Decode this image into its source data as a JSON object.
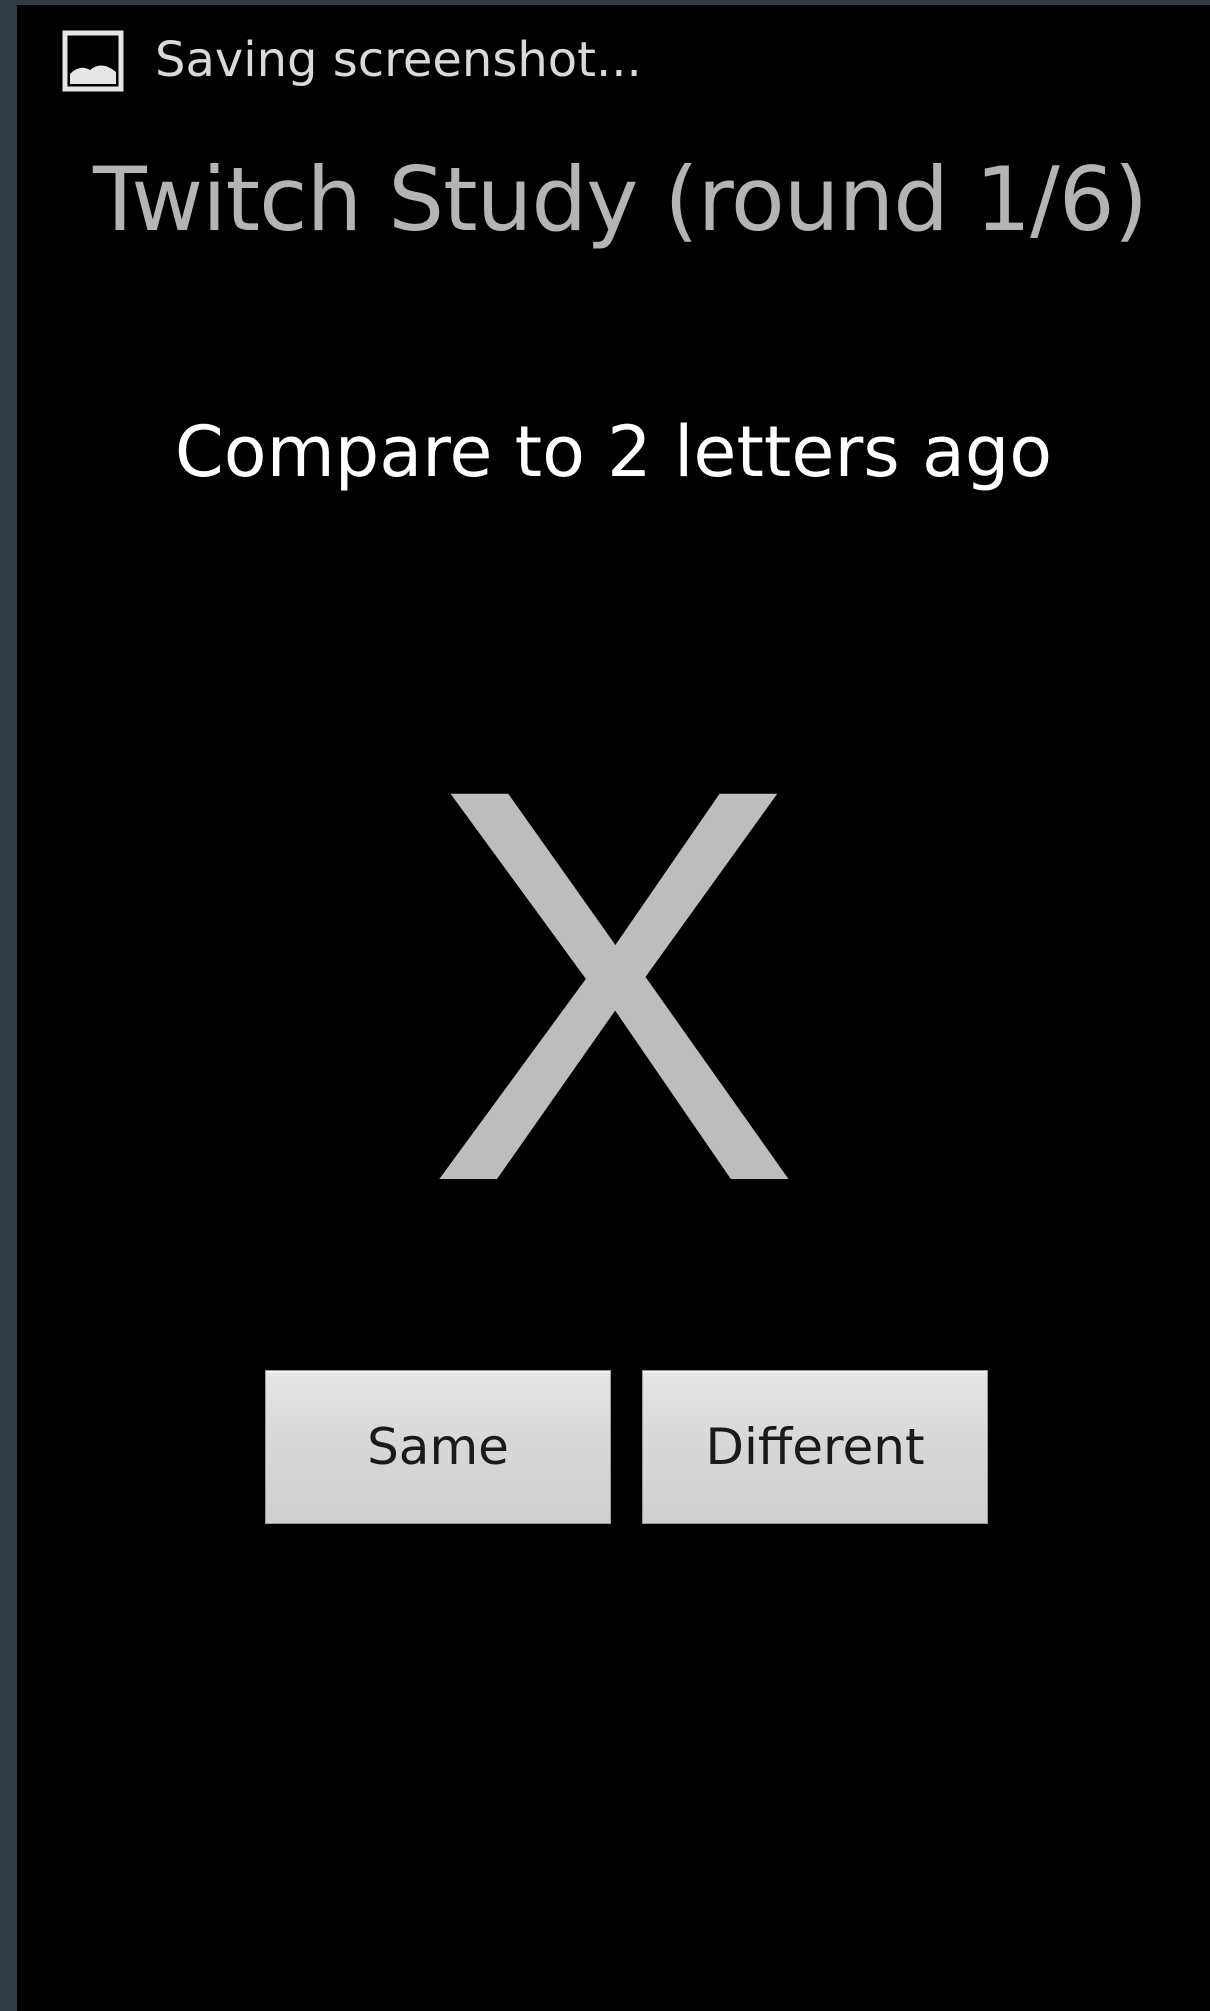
{
  "status_bar": {
    "notification_icon": "image-icon",
    "notification_text": "Saving screenshot..."
  },
  "app": {
    "title": "Twitch Study (round 1/6)",
    "instruction": "Compare to 2 letters ago",
    "current_letter": "X"
  },
  "buttons": {
    "same_label": "Same",
    "different_label": "Different"
  },
  "colors": {
    "background": "#000000",
    "frame": "#323a42",
    "title_text": "#b4b4b4",
    "instruction_text": "#ffffff",
    "letter": "#bdbdbd",
    "button_face": "#d8d8d8"
  }
}
